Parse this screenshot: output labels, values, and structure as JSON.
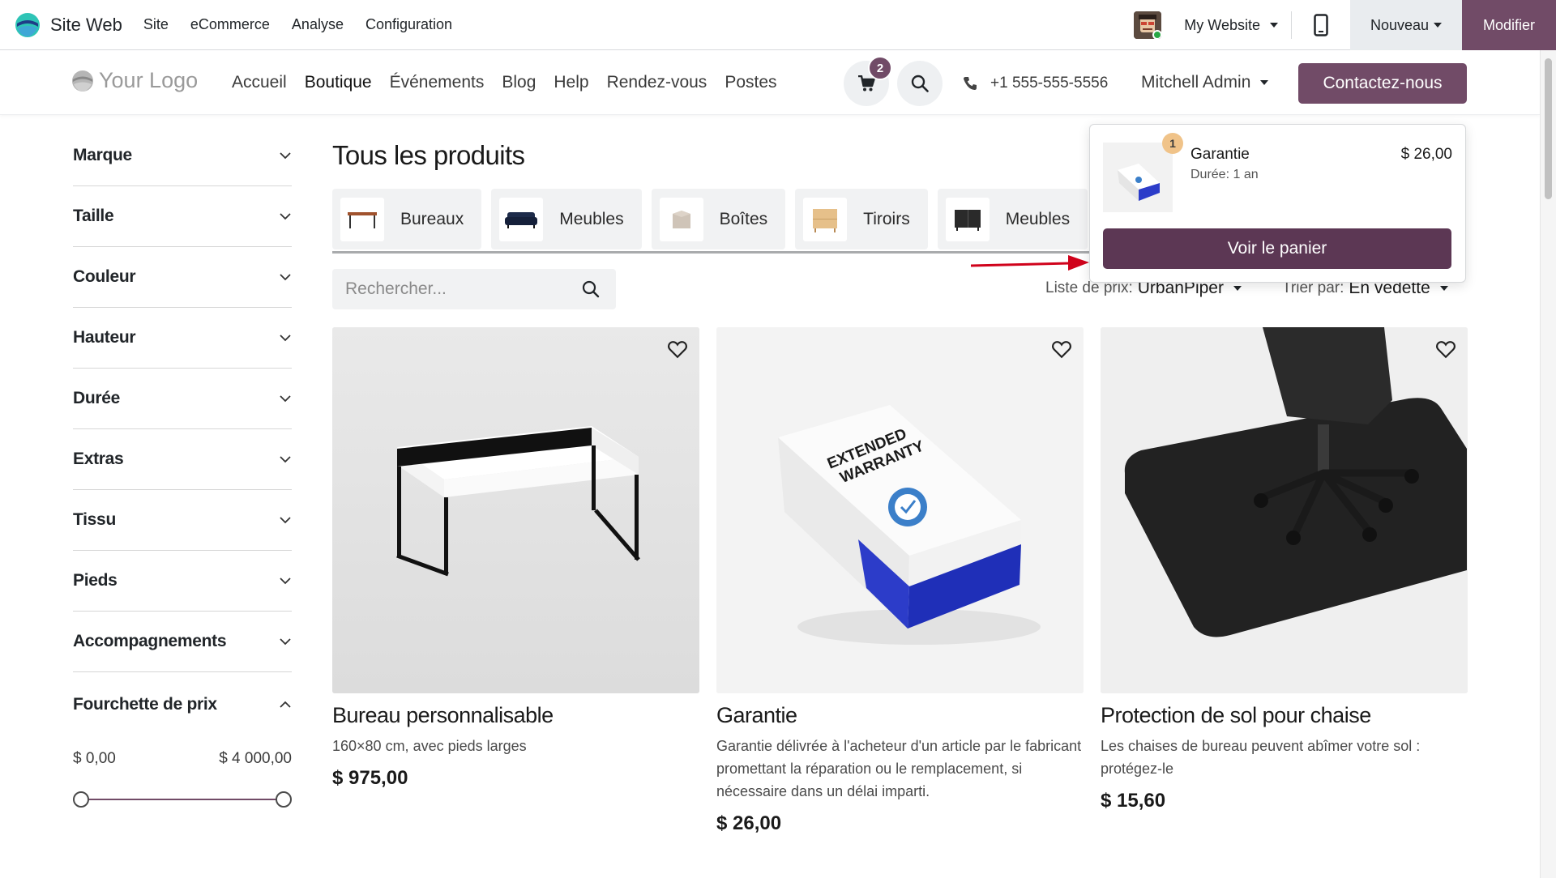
{
  "adminbar": {
    "app_name": "Site Web",
    "menu": [
      "Site",
      "eCommerce",
      "Analyse",
      "Configuration"
    ],
    "website_selector": "My Website",
    "new_label": "Nouveau",
    "edit_label": "Modifier"
  },
  "header": {
    "logo_text": "Your Logo",
    "nav": [
      "Accueil",
      "Boutique",
      "Événements",
      "Blog",
      "Help",
      "Rendez-vous",
      "Postes"
    ],
    "active_nav": "Boutique",
    "cart_count": "2",
    "phone": "+1 555-555-5556",
    "user": "Mitchell Admin",
    "contact_label": "Contactez-nous"
  },
  "sidebar": {
    "filters": [
      "Marque",
      "Taille",
      "Couleur",
      "Hauteur",
      "Durée",
      "Extras",
      "Tissu",
      "Pieds",
      "Accompagnements"
    ],
    "price_range": {
      "label": "Fourchette de prix",
      "min": "$ 0,00",
      "max": "$ 4 000,00"
    }
  },
  "main": {
    "title": "Tous les produits",
    "categories": [
      "Bureaux",
      "Meubles",
      "Boîtes",
      "Tiroirs",
      "Meubles"
    ],
    "search_placeholder": "Rechercher...",
    "pricelist_label": "Liste de prix:",
    "pricelist_value": "UrbanPiper",
    "sort_label": "Trier par:",
    "sort_value": "En vedette"
  },
  "products": [
    {
      "name": "Bureau personnalisable",
      "description": "160×80 cm, avec pieds larges",
      "price": "$ 975,00"
    },
    {
      "name": "Garantie",
      "description": "Garantie délivrée à l'acheteur d'un article par le fabricant promettant la réparation ou le remplacement, si nécessaire dans un délai imparti.",
      "price": "$ 26,00",
      "image_text": "EXTENDED WARRANTY"
    },
    {
      "name": "Protection de sol pour chaise",
      "description": "Les chaises de bureau peuvent abîmer votre sol : protégez-le",
      "price": "$ 15,60"
    }
  ],
  "cart_popover": {
    "quantity": "1",
    "product": "Garantie",
    "detail": "Durée: 1 an",
    "price": "$ 26,00",
    "button": "Voir le panier"
  },
  "colors": {
    "brand_purple": "#714b67",
    "cart_button": "#5c3754",
    "qty_badge": "#f0c389",
    "arrow": "#d0021b"
  }
}
